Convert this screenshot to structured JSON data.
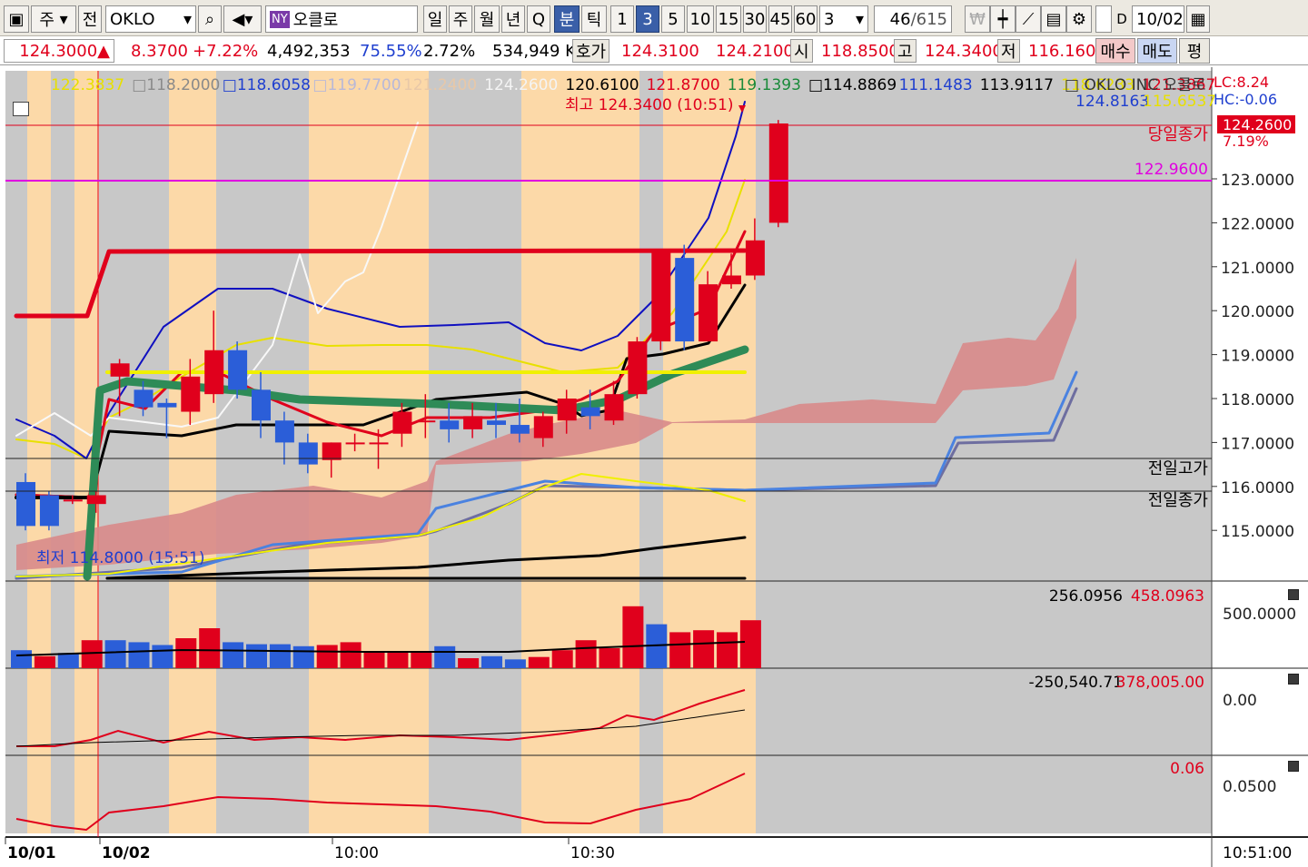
{
  "toolbar": {
    "mode": "주",
    "all_btn": "전",
    "symbol": "OKLO",
    "exchange_badge": "NY",
    "symbol_name": "오클로",
    "periods": [
      "일",
      "주",
      "월",
      "년",
      "Q",
      "분",
      "틱"
    ],
    "selected_period": "분",
    "intervals": [
      "1",
      "3",
      "5",
      "10",
      "15",
      "30",
      "45",
      "60"
    ],
    "selected_interval": "3",
    "custom_interval": "3",
    "page_current": "46",
    "page_total": "/615",
    "date_label": "D",
    "date": "10/02"
  },
  "quote": {
    "price": "124.3000",
    "change": "8.3700",
    "change_pct": "+7.22%",
    "volume": "4,492,353",
    "vol_ratio": "75.55%",
    "turnover": "2.72%",
    "amount": "534,949 K",
    "hoga_label": "호가",
    "ask": "124.3100",
    "bid": "124.2100",
    "open_label": "시",
    "open": "118.8500",
    "high_label": "고",
    "high": "124.3400",
    "low_label": "저",
    "low": "116.1600",
    "buy_label": "매수",
    "sell_label": "매도",
    "avg_label": "평"
  },
  "main_legend": [
    {
      "text": "122.3837",
      "color": "#e8e000"
    },
    {
      "text": "□118.2000",
      "color": "#8a8a8a"
    },
    {
      "text": "□118.6058",
      "color": "#1f3fcf"
    },
    {
      "text": "□119.7700",
      "color": "#b8b8d8"
    },
    {
      "text": "121.2400",
      "color": "#e8c8a8"
    },
    {
      "text": "124.2600",
      "color": "#f4f4f4"
    },
    {
      "text": "120.6100",
      "color": "#000000"
    },
    {
      "text": "121.8700",
      "color": "#e0001c"
    },
    {
      "text": "119.1393",
      "color": "#1a8a3a"
    },
    {
      "text": "□114.8869",
      "color": "#000000"
    },
    {
      "text": "111.1483",
      "color": "#1f3fcf"
    },
    {
      "text": "113.9117",
      "color": "#000000"
    },
    {
      "text": "118.6233",
      "color": "#e8e000"
    },
    {
      "text": "121.3867",
      "color": "#e0001c"
    }
  ],
  "company_name": "□ OKLO INC 오클로",
  "lc_label": "LC:8.24",
  "hc_label": "HC:-0.06",
  "right_vals": [
    {
      "text": "124.8163",
      "color": "#1f3fcf"
    },
    {
      "text": "115.6537",
      "color": "#e8e000"
    }
  ],
  "high_annotation": "최고 124.3400 (10:51)",
  "low_annotation": "최저 114.8000 (15:51)",
  "current_price_tag": "124.2600",
  "current_change_tag": "7.19%",
  "today_close_label": "당일종가",
  "magenta_level_label": "122.9600",
  "prev_high_label": "전일고가",
  "prev_close_label": "전일종가",
  "volume_panel": {
    "v1": "256.0956",
    "v2": "458.0963",
    "axis": "500.0000"
  },
  "osc1_panel": {
    "v1": "-250,540.71",
    "v2": "378,005.00",
    "axis": "0.00"
  },
  "osc2_panel": {
    "v1": "0.06",
    "axis": "0.0500"
  },
  "time_axis": {
    "labels": [
      "10/01",
      "10/02",
      "10:00",
      "10:30"
    ],
    "right": "10:51:00"
  },
  "colors": {
    "up": "#e0001c",
    "down": "#2b5ed8",
    "bg_gray": "#c8c8c8",
    "bg_orange": "#fcd9a8",
    "cloud": "#d88a8a"
  },
  "chart_data": {
    "type": "candlestick",
    "y_ticks": [
      124,
      123,
      122,
      121,
      120,
      119,
      118,
      117,
      116,
      115
    ],
    "ylim": [
      114.1,
      125.1
    ],
    "slot_count": 32,
    "candles": [
      {
        "o": 116.1,
        "h": 116.3,
        "l": 115.0,
        "c": 115.1
      },
      {
        "o": 115.8,
        "h": 115.9,
        "l": 115.0,
        "c": 115.1
      },
      {
        "o": 115.7,
        "h": 115.8,
        "l": 115.6,
        "c": 115.7
      },
      {
        "o": 115.6,
        "h": 115.9,
        "l": 115.4,
        "c": 115.8
      },
      {
        "o": 118.5,
        "h": 118.9,
        "l": 117.6,
        "c": 118.8
      },
      {
        "o": 118.2,
        "h": 118.4,
        "l": 117.6,
        "c": 117.8
      },
      {
        "o": 117.9,
        "h": 118.0,
        "l": 117.1,
        "c": 117.8
      },
      {
        "o": 117.7,
        "h": 118.9,
        "l": 117.4,
        "c": 118.5
      },
      {
        "o": 118.1,
        "h": 120.0,
        "l": 117.9,
        "c": 119.1
      },
      {
        "o": 119.1,
        "h": 119.3,
        "l": 118.0,
        "c": 118.2
      },
      {
        "o": 118.2,
        "h": 118.6,
        "l": 117.1,
        "c": 117.5
      },
      {
        "o": 117.5,
        "h": 117.7,
        "l": 116.5,
        "c": 117.0
      },
      {
        "o": 117.0,
        "h": 117.2,
        "l": 116.3,
        "c": 116.5
      },
      {
        "o": 116.6,
        "h": 117.0,
        "l": 116.2,
        "c": 117.0
      },
      {
        "o": 117.0,
        "h": 117.2,
        "l": 116.8,
        "c": 117.0
      },
      {
        "o": 117.0,
        "h": 117.3,
        "l": 116.4,
        "c": 117.0
      },
      {
        "o": 117.2,
        "h": 117.9,
        "l": 116.9,
        "c": 117.7
      },
      {
        "o": 117.5,
        "h": 118.1,
        "l": 117.1,
        "c": 117.5
      },
      {
        "o": 117.5,
        "h": 117.9,
        "l": 117.0,
        "c": 117.3
      },
      {
        "o": 117.3,
        "h": 117.9,
        "l": 117.1,
        "c": 117.6
      },
      {
        "o": 117.5,
        "h": 117.9,
        "l": 117.1,
        "c": 117.4
      },
      {
        "o": 117.4,
        "h": 118.0,
        "l": 117.0,
        "c": 117.2
      },
      {
        "o": 117.1,
        "h": 117.7,
        "l": 116.9,
        "c": 117.6
      },
      {
        "o": 117.5,
        "h": 118.2,
        "l": 117.2,
        "c": 118.0
      },
      {
        "o": 117.8,
        "h": 118.2,
        "l": 117.3,
        "c": 117.6
      },
      {
        "o": 117.5,
        "h": 118.4,
        "l": 117.4,
        "c": 118.1
      },
      {
        "o": 118.1,
        "h": 119.4,
        "l": 118.0,
        "c": 119.3
      },
      {
        "o": 119.3,
        "h": 121.4,
        "l": 119.1,
        "c": 121.4
      },
      {
        "o": 121.2,
        "h": 121.5,
        "l": 119.1,
        "c": 119.3
      },
      {
        "o": 119.3,
        "h": 120.9,
        "l": 119.3,
        "c": 120.6
      },
      {
        "o": 120.6,
        "h": 121.3,
        "l": 120.5,
        "c": 120.8
      },
      {
        "o": 120.8,
        "h": 122.1,
        "l": 120.7,
        "c": 121.6
      },
      {
        "o": 122.0,
        "h": 124.34,
        "l": 121.9,
        "c": 124.26
      }
    ],
    "volume": [
      {
        "v": 0.45,
        "d": "down"
      },
      {
        "v": 0.3,
        "d": "up"
      },
      {
        "v": 0.38,
        "d": "down"
      },
      {
        "v": 0.7,
        "d": "up"
      },
      {
        "v": 0.7,
        "d": "down"
      },
      {
        "v": 0.65,
        "d": "down"
      },
      {
        "v": 0.58,
        "d": "down"
      },
      {
        "v": 0.75,
        "d": "up"
      },
      {
        "v": 1.0,
        "d": "up"
      },
      {
        "v": 0.65,
        "d": "down"
      },
      {
        "v": 0.6,
        "d": "down"
      },
      {
        "v": 0.6,
        "d": "down"
      },
      {
        "v": 0.55,
        "d": "down"
      },
      {
        "v": 0.58,
        "d": "up"
      },
      {
        "v": 0.65,
        "d": "up"
      },
      {
        "v": 0.4,
        "d": "up"
      },
      {
        "v": 0.4,
        "d": "up"
      },
      {
        "v": 0.4,
        "d": "up"
      },
      {
        "v": 0.55,
        "d": "down"
      },
      {
        "v": 0.25,
        "d": "up"
      },
      {
        "v": 0.3,
        "d": "down"
      },
      {
        "v": 0.22,
        "d": "down"
      },
      {
        "v": 0.28,
        "d": "up"
      },
      {
        "v": 0.45,
        "d": "up"
      },
      {
        "v": 0.7,
        "d": "up"
      },
      {
        "v": 0.5,
        "d": "up"
      },
      {
        "v": 1.55,
        "d": "up"
      },
      {
        "v": 1.1,
        "d": "down"
      },
      {
        "v": 0.9,
        "d": "up"
      },
      {
        "v": 0.95,
        "d": "up"
      },
      {
        "v": 0.9,
        "d": "up"
      },
      {
        "v": 1.2,
        "d": "up"
      }
    ]
  }
}
